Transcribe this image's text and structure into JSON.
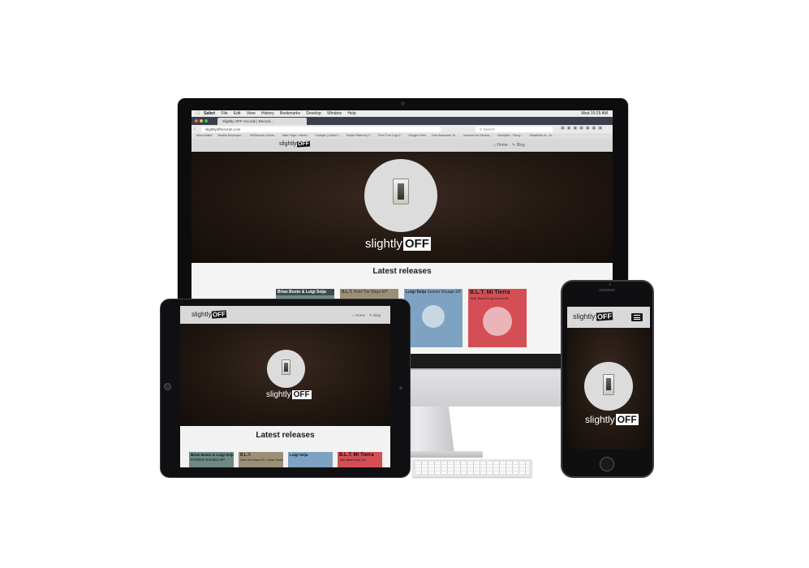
{
  "desktop": {
    "menubar": {
      "app": "Safari",
      "menus": [
        "File",
        "Edit",
        "View",
        "History",
        "Bookmarks",
        "Develop",
        "Window",
        "Help"
      ],
      "right": "Wed 10:25 AM"
    },
    "tab_title": "Slightly OFF records | Record...",
    "url": "slightlyoffrecords.com",
    "search_placeholder": "Search",
    "bookmarks": [
      "Most Visited",
      "Mozilla Developer ...",
      "W3Schools Online...",
      "Main Page » World...",
      "Codrops | Useful I...",
      "Subtle Patterns | F...",
      "Free Font Logo F...",
      "Google Fonts",
      "Font Awesome, th...",
      "Vermont Ice Genera...",
      "Familyfan - Fancy ...",
      "Whatfonts.co - th..."
    ],
    "nav": [
      "Home",
      "Blog"
    ],
    "section_title": "Latest releases",
    "releases": [
      {
        "artist": "Brian Busto & Luigi Seija",
        "title": "",
        "color": "#6d8a85"
      },
      {
        "artist": "B.L.T.",
        "title": "Hold The Mayo EP",
        "color": "#9b8f76"
      },
      {
        "artist": "Luigi Seija",
        "title": "Sunset Voyage EP",
        "color": "#7ea3c2"
      },
      {
        "artist": "B.L.T. Mi Tierra",
        "title": "feat. Band Drop-Out remix",
        "color": "#d44e55"
      }
    ]
  },
  "tablet": {
    "nav": [
      "Home",
      "Blog"
    ],
    "section_title": "Latest releases",
    "releases": [
      {
        "artist": "Brian Busto & Luigi Seija",
        "title": "Primitive Emotion EP",
        "color": "#6d8a85"
      },
      {
        "artist": "B.L.T.",
        "title": "Hold The Mayo EP / Jesse Scotti",
        "color": "#9b8f76"
      },
      {
        "artist": "Luigi Seija",
        "title": "",
        "color": "#7ea3c2"
      },
      {
        "artist": "B.L.T. Mi Tierra",
        "title": "feat. Band Drop-Out",
        "color": "#d44e55"
      }
    ]
  },
  "brand": {
    "logo_text": "slightly",
    "logo_off": "OFF"
  }
}
